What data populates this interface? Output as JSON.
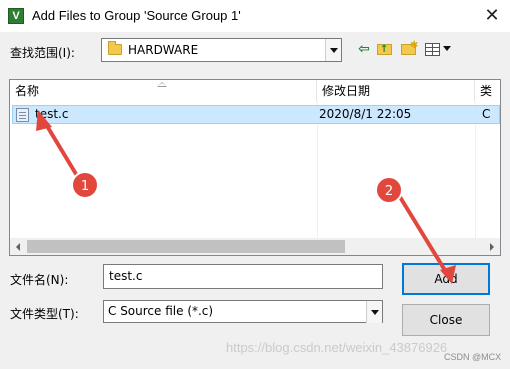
{
  "window": {
    "title": "Add Files to Group 'Source Group 1'",
    "icon_letter": "V",
    "close_glyph": "✕"
  },
  "lookin": {
    "label": "查找范围(I):",
    "value": "HARDWARE"
  },
  "toolbar": {
    "back_glyph": "⇦",
    "new_glyph": "✱"
  },
  "filelist": {
    "columns": [
      "名称",
      "修改日期",
      "类"
    ],
    "rows": [
      {
        "name": "test.c",
        "date": "2020/8/1 22:05",
        "type": "C"
      }
    ]
  },
  "filename": {
    "label": "文件名(N):",
    "value": "test.c"
  },
  "filetype": {
    "label": "文件类型(T):",
    "value": "C Source file (*.c)"
  },
  "buttons": {
    "add": "Add",
    "close": "Close"
  },
  "annotations": {
    "badge1": "1",
    "badge2": "2",
    "color": "#e2473d"
  },
  "watermark": {
    "text": "https://blog.csdn.net/weixin_43876926",
    "small": "CSDN @MCX"
  }
}
